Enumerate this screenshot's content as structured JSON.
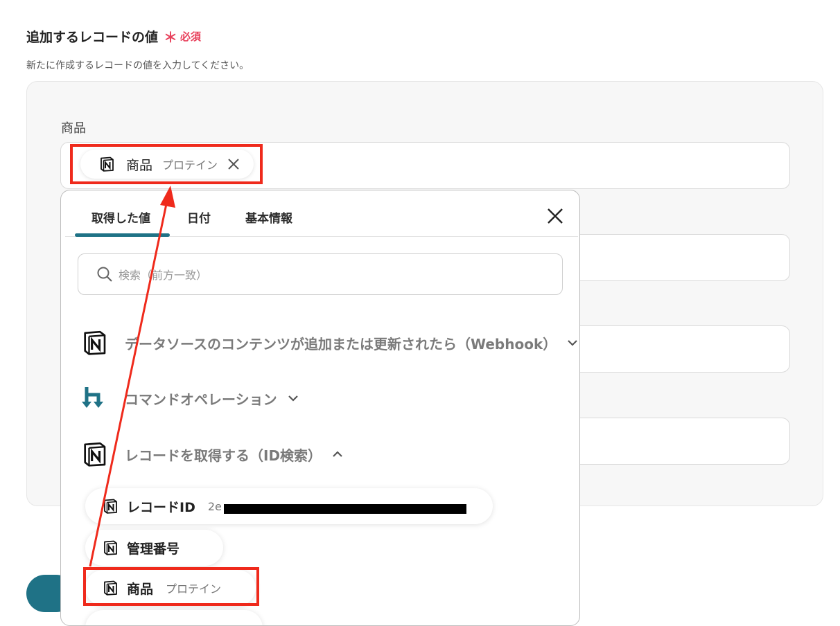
{
  "section": {
    "title": "追加するレコードの値",
    "required_mark": "＊",
    "required_label": "必須",
    "description": "新たに作成するレコードの値を入力してください。"
  },
  "field": {
    "label": "商品"
  },
  "chip": {
    "name": "商品",
    "value": "プロテイン"
  },
  "popup": {
    "tabs": [
      {
        "label": "取得した値"
      },
      {
        "label": "日付"
      },
      {
        "label": "基本情報"
      }
    ],
    "search_placeholder": "検索（前方一致）",
    "groups": [
      {
        "label": "データソースのコンテンツが追加または更新されたら（Webhook）",
        "icon": "notion-icon",
        "state": "collapsed"
      },
      {
        "label": "コマンドオペレーション",
        "icon": "yoom-icon",
        "state": "collapsed"
      },
      {
        "label": "レコードを取得する（ID検索）",
        "icon": "notion-icon",
        "state": "expanded"
      }
    ],
    "items": [
      {
        "name": "レコードID",
        "value": "2e"
      },
      {
        "name": "管理番号",
        "value": ""
      },
      {
        "name": "商品",
        "value": "プロテイン"
      }
    ]
  },
  "colors": {
    "accent": "#1f7286",
    "required": "#e8415c",
    "highlight": "#ef2a1c"
  }
}
